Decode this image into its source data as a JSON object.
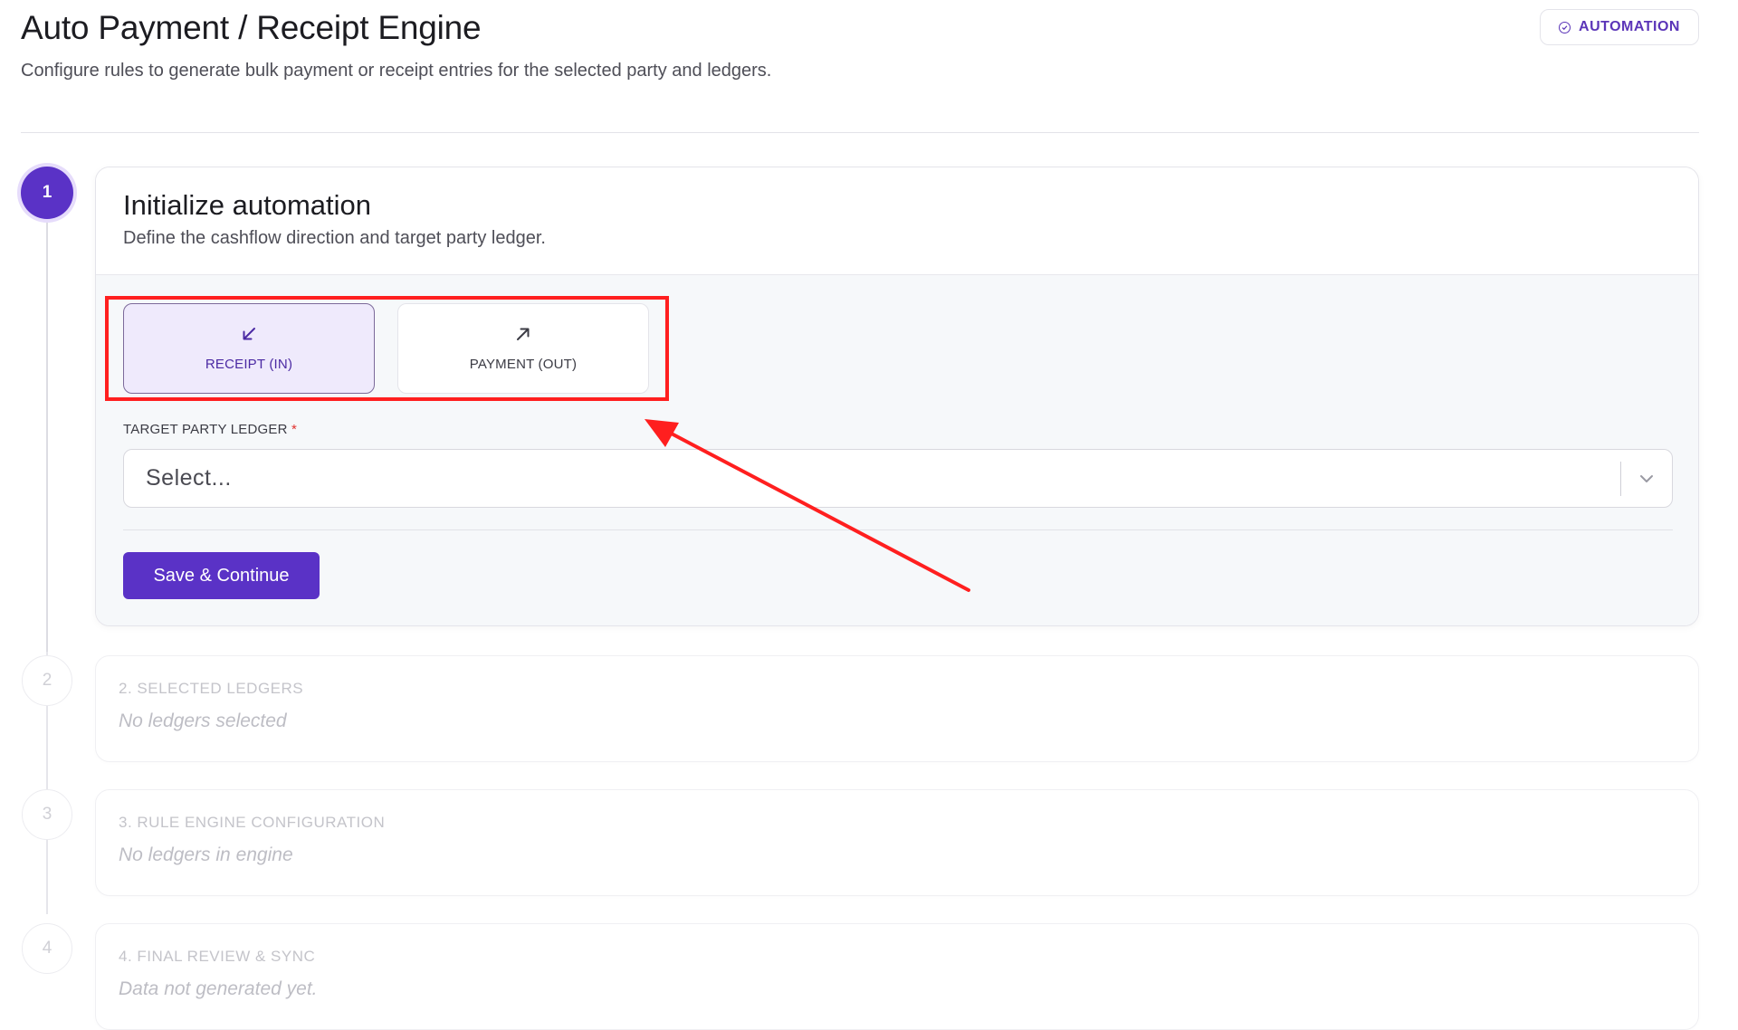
{
  "header": {
    "title": "Auto Payment / Receipt Engine",
    "subtitle": "Configure rules to generate bulk payment or receipt entries for the selected party and ledgers.",
    "badge": "AUTOMATION"
  },
  "steps": [
    {
      "number": "1",
      "status": "active"
    },
    {
      "number": "2",
      "status": "inactive"
    },
    {
      "number": "3",
      "status": "inactive"
    },
    {
      "number": "4",
      "status": "inactive"
    }
  ],
  "step1": {
    "title": "Initialize automation",
    "description": "Define the cashflow direction and target party ledger.",
    "directions": [
      {
        "label": "RECEIPT (IN)",
        "icon": "arrow-down-left-icon",
        "selected": true
      },
      {
        "label": "PAYMENT (OUT)",
        "icon": "arrow-up-right-icon",
        "selected": false
      }
    ],
    "field_label": "TARGET PARTY LEDGER",
    "required_mark": "*",
    "select_value": "Select...",
    "save_label": "Save & Continue"
  },
  "step2": {
    "title": "2. SELECTED LEDGERS",
    "description": "No ledgers selected"
  },
  "step3": {
    "title": "3. RULE ENGINE CONFIGURATION",
    "description": "No ledgers in engine"
  },
  "step4": {
    "title": "4. FINAL REVIEW & SYNC",
    "description": "Data not generated yet."
  },
  "colors": {
    "accent": "#5a32c6",
    "annotation": "#ff1f1f"
  }
}
